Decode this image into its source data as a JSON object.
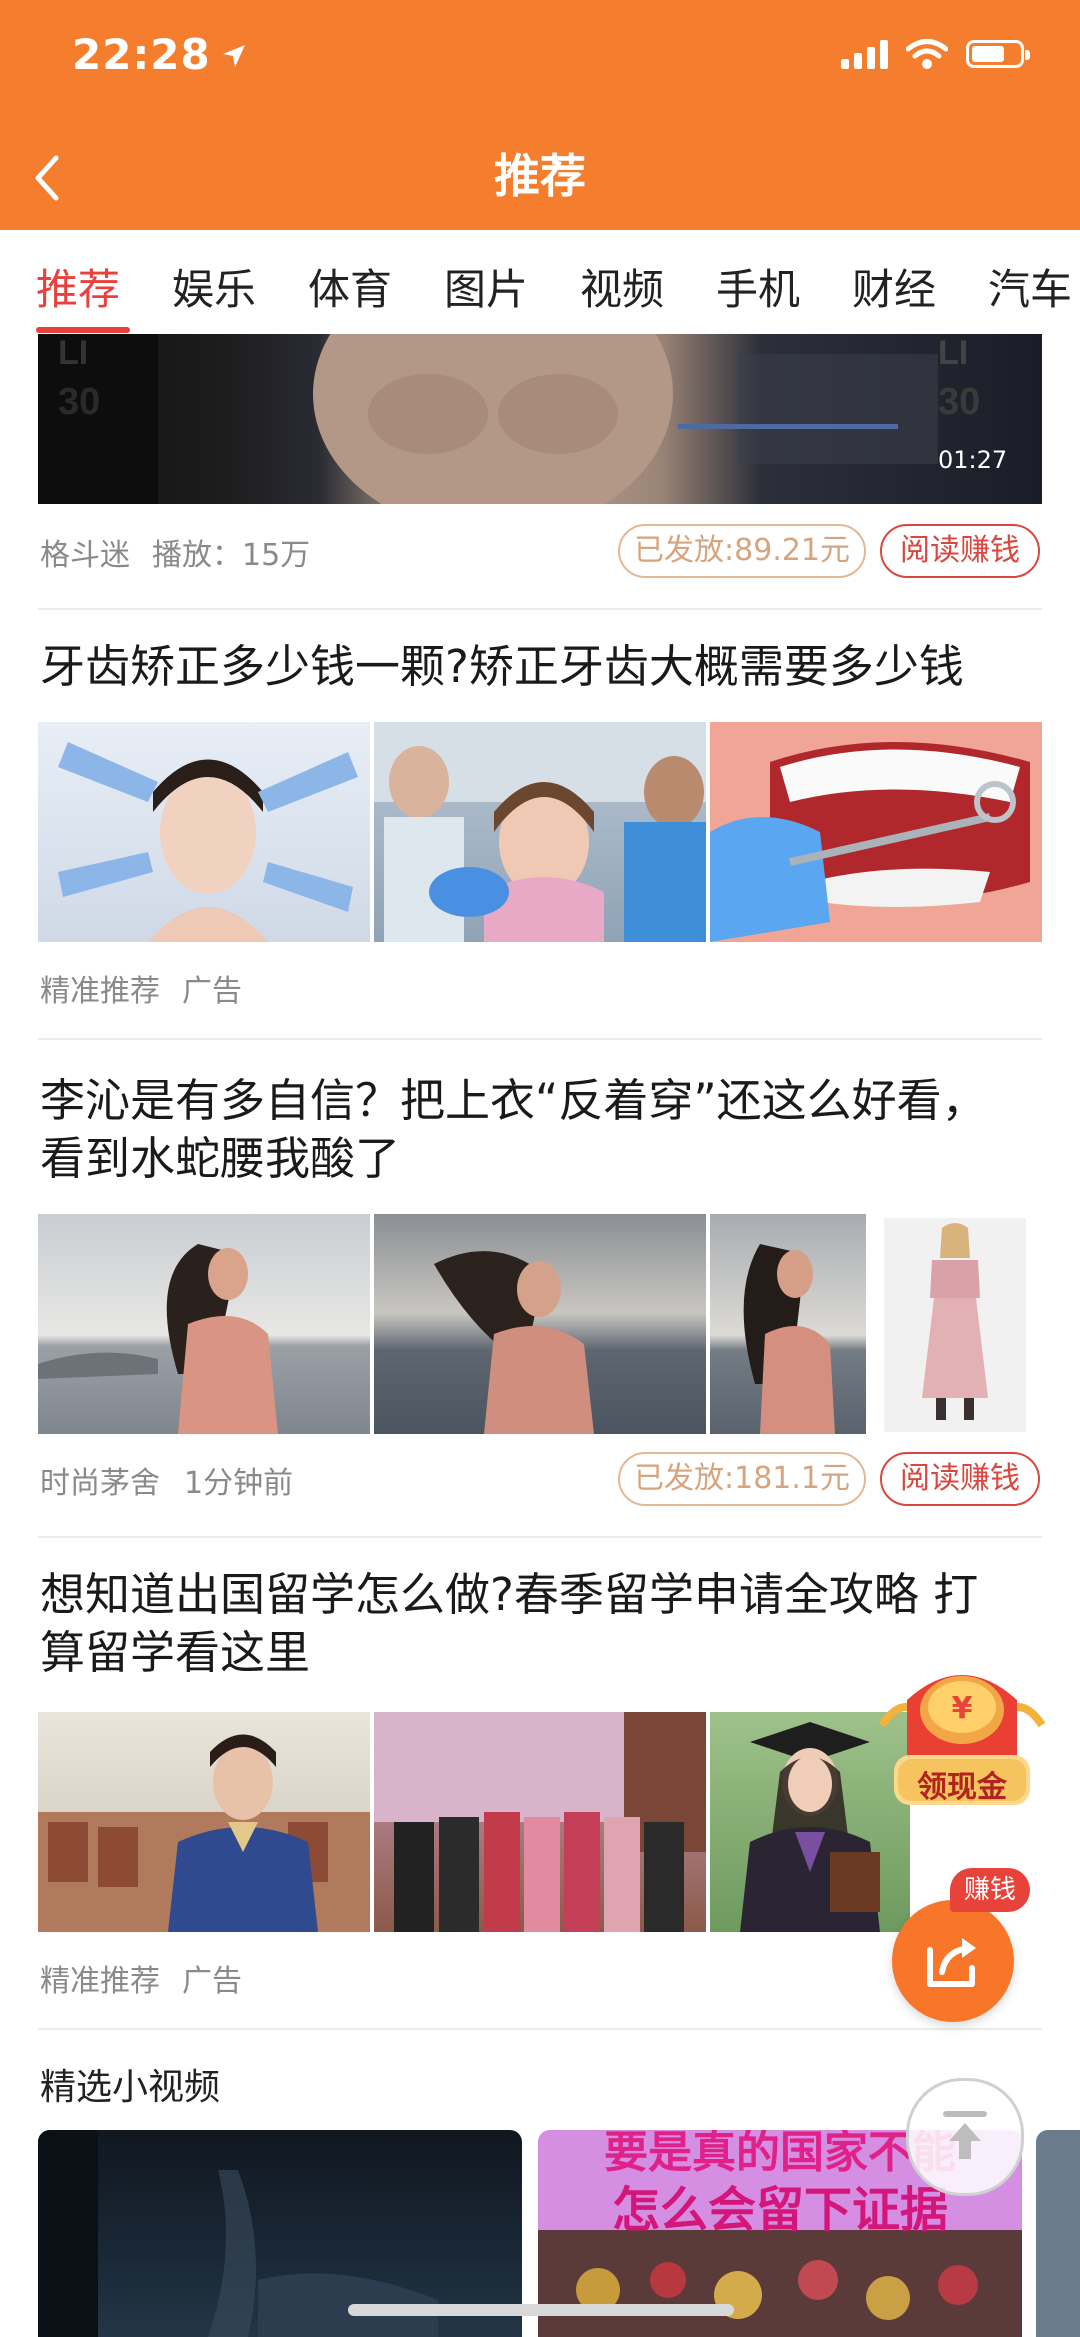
{
  "status_bar": {
    "time": "22:28"
  },
  "header": {
    "title": "推荐"
  },
  "tabs": [
    "推荐",
    "娱乐",
    "体育",
    "图片",
    "视频",
    "手机",
    "财经",
    "汽车"
  ],
  "active_tab": 0,
  "video_item": {
    "duration": "01:27",
    "source": "格斗迷",
    "plays": "播放：15万",
    "paid": "已发放:89.21元",
    "earn": "阅读赚钱"
  },
  "ad1": {
    "title": "牙齿矫正多少钱一颗?矫正牙齿大概需要多少钱",
    "source": "精准推荐",
    "tag": "广告"
  },
  "article2": {
    "title_line1": "李沁是有多自信？把上衣“反着穿”还这么好看，",
    "title_line2": "看到水蛇腰我酸了",
    "source": "时尚茅舍",
    "time": "1分钟前",
    "paid": "已发放:181.1元",
    "earn": "阅读赚钱"
  },
  "ad2": {
    "title_line1": "想知道出国留学怎么做?春季留学申请全攻略 打",
    "title_line2": "算留学看这里",
    "source": "精准推荐",
    "tag": "广告"
  },
  "short_videos": {
    "title": "精选小视频",
    "card2_overlay_line1": "要是真的国家不能",
    "card2_overlay_line2": "怎么会留下证据"
  },
  "floating": {
    "cash_label": "领现金",
    "earn_tag": "赚钱"
  }
}
